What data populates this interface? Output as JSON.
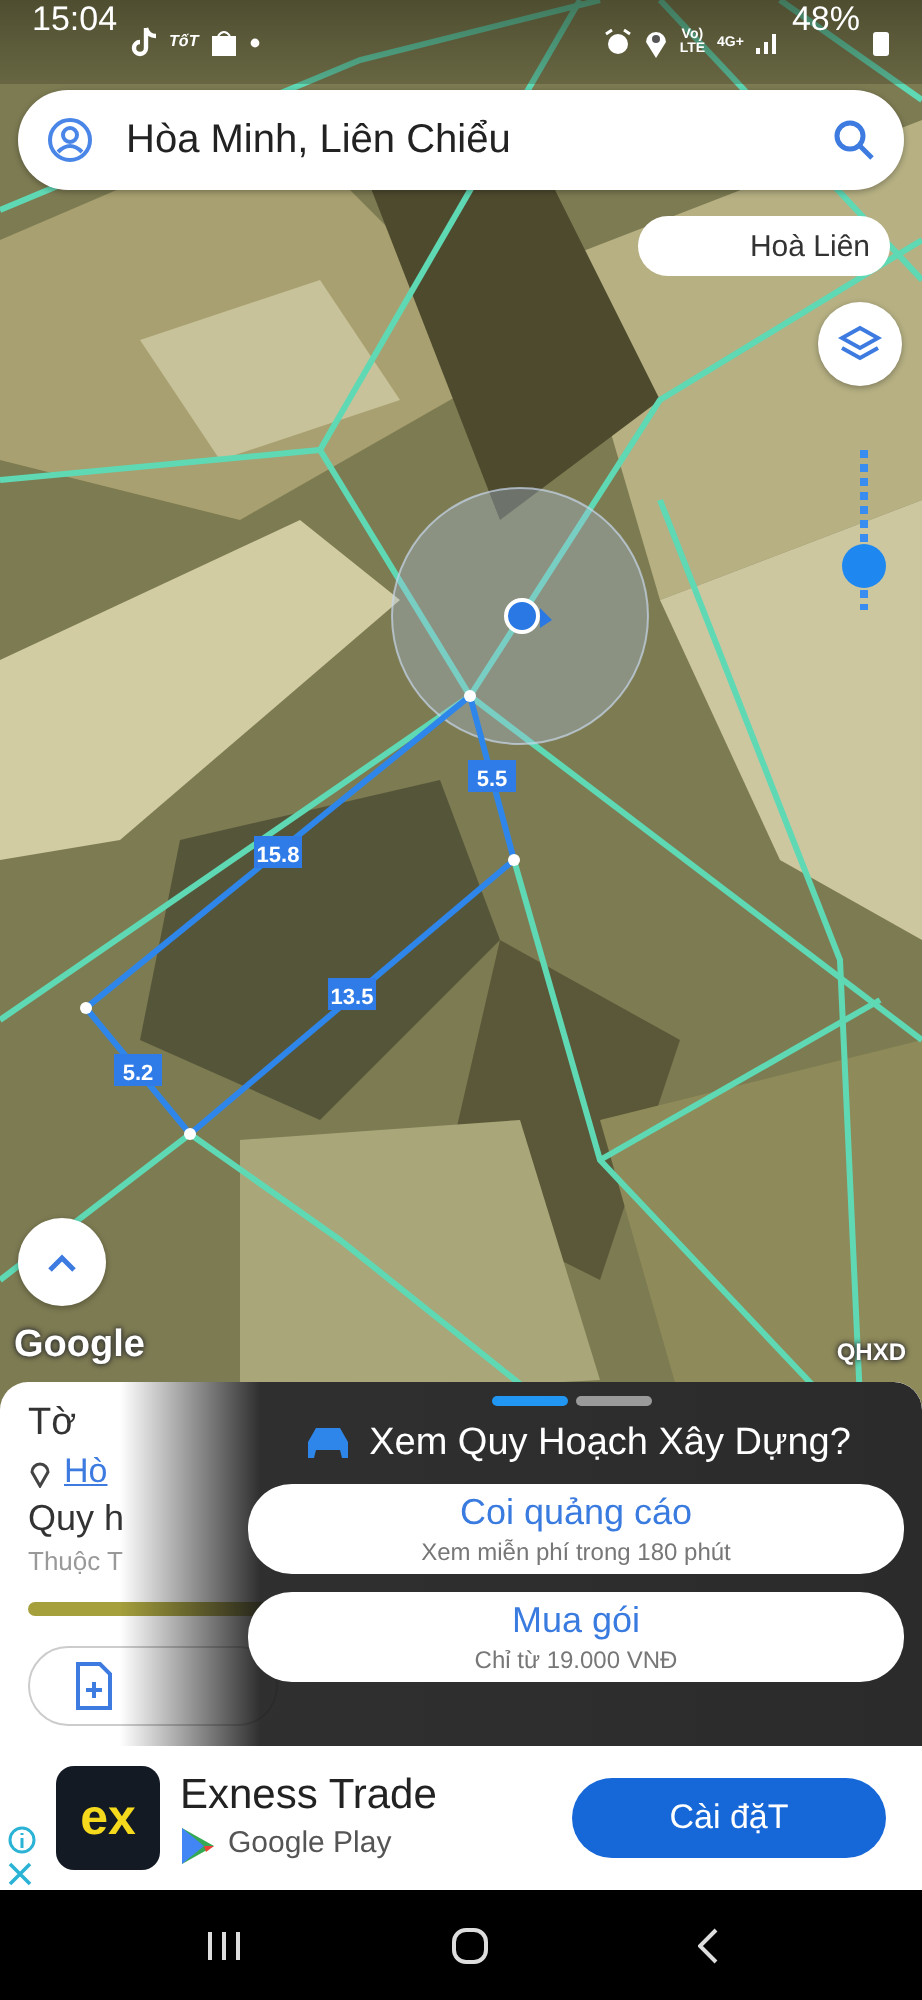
{
  "status_bar": {
    "time": "15:04",
    "notification_label": "TốT",
    "volte": [
      "Vo)",
      "LTE"
    ],
    "network": "4G+",
    "battery": "48%"
  },
  "search": {
    "value": "Hòa Minh, Liên Chiểu"
  },
  "map": {
    "place_chip": "Hoà Liên",
    "opacity_slider": {
      "level": 0.28
    },
    "plot_edges": [
      {
        "length": "5.5"
      },
      {
        "length": "13.5"
      },
      {
        "length": "5.2"
      },
      {
        "length": "15.8"
      }
    ],
    "attribution": "Google",
    "layer_badge": "QHXD"
  },
  "sheet": {
    "title_fragment": "Tờ",
    "address_fragment": "Hò",
    "planning_fragment": "Quy h",
    "subtitle_fragment": "Thuộc T"
  },
  "dialog": {
    "pages": [
      {
        "selected": true
      },
      {
        "selected": false
      }
    ],
    "title": "Xem Quy Hoạch Xây Dựng?",
    "options": [
      {
        "title": "Coi quảng cáo",
        "subtitle": "Xem miễn phí trong 180 phút"
      },
      {
        "title": "Mua gói",
        "subtitle": "Chỉ từ 19.000 VNĐ"
      }
    ]
  },
  "ad": {
    "logo": "ex",
    "app_name": "Exness Trade",
    "store": "Google Play",
    "button": "Cài đặT"
  }
}
